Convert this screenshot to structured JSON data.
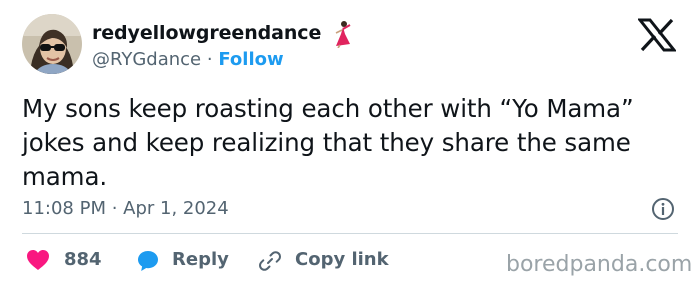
{
  "author": {
    "display_name": "redyellowgreendance",
    "handle": "@RYGdance",
    "separator": "·",
    "follow_label": "Follow"
  },
  "tweet": {
    "text": "My sons keep roasting each other with “Yo Mama” jokes and keep realizing that they share the same mama.",
    "timestamp": "11:08 PM · Apr 1, 2024"
  },
  "actions": {
    "like_count": "884",
    "reply_label": "Reply",
    "copy_label": "Copy link"
  },
  "watermark": "boredpanda.com",
  "colors": {
    "text": "#0f1419",
    "muted": "#536471",
    "link": "#1d9bf0",
    "heart": "#f91880",
    "divider": "#cfd9de"
  },
  "icons": {
    "dancer": "dancer-emoji-icon",
    "x_logo": "x-logo-icon",
    "info": "info-icon",
    "heart": "heart-icon",
    "reply": "speech-bubble-icon",
    "copy": "link-icon"
  }
}
